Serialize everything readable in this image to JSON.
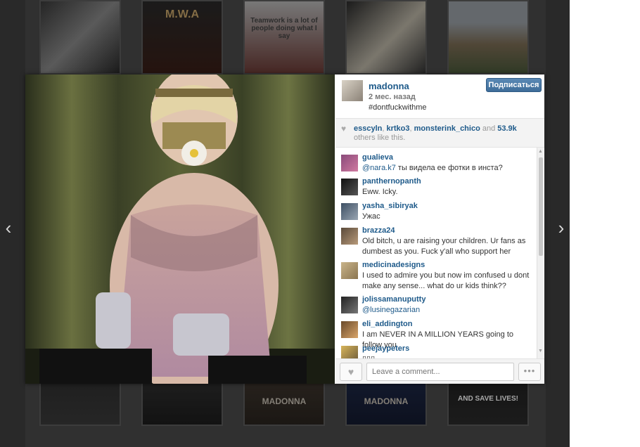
{
  "thumbnails_top": [
    {
      "caption": ""
    },
    {
      "caption": "M.W.A"
    },
    {
      "caption": "Teamwork is a lot of people doing what I say"
    },
    {
      "caption": ""
    },
    {
      "caption": ""
    }
  ],
  "thumbnails_bottom": [
    {
      "caption": ""
    },
    {
      "caption": ""
    },
    {
      "caption": "MADONNA"
    },
    {
      "caption": "MADONNA"
    },
    {
      "caption": "AND SAVE LIVES!"
    }
  ],
  "nav": {
    "prev_icon": "‹",
    "next_icon": "›"
  },
  "post": {
    "username": "madonna",
    "time_ago": "2 мес. назад",
    "caption": "#dontfuckwithme",
    "follow_label": "Подписаться"
  },
  "likes": {
    "heart_icon": "♥",
    "user1": "esscyln",
    "user2": "krtko3",
    "user3": "monsterink_chico",
    "count": "53.9k",
    "sep": ", ",
    "and_text": " and ",
    "suffix": " others like this."
  },
  "comments": [
    {
      "username": "gualieva",
      "mention": "@nara.k7",
      "text": " ты видела ее фотки в инста?"
    },
    {
      "username": "panthernopanth",
      "mention": "",
      "text": "Eww. Icky."
    },
    {
      "username": "yasha_sibiryak",
      "mention": "",
      "text": "Ужас"
    },
    {
      "username": "brazza24",
      "mention": "",
      "text": "Old bitch, u are raising your children. Ur fans as dumbest as you. Fuck y'all who support her"
    },
    {
      "username": "medicinadesigns",
      "mention": "",
      "text": "I used to admire you but now im confused u dont make any sense... what do ur kids think??"
    },
    {
      "username": "jolissamanuputty",
      "mention": "@lusinegazarian",
      "text": ""
    },
    {
      "username": "eli_addington",
      "mention": "",
      "text": "I am NEVER IN A MILLION YEARS going to follow you"
    },
    {
      "username": "peejaypeters",
      "mention": "",
      "text": "▯▯▯"
    }
  ],
  "footer": {
    "like_icon": "♥",
    "comment_placeholder": "Leave a comment...",
    "more_icon": "•••"
  }
}
